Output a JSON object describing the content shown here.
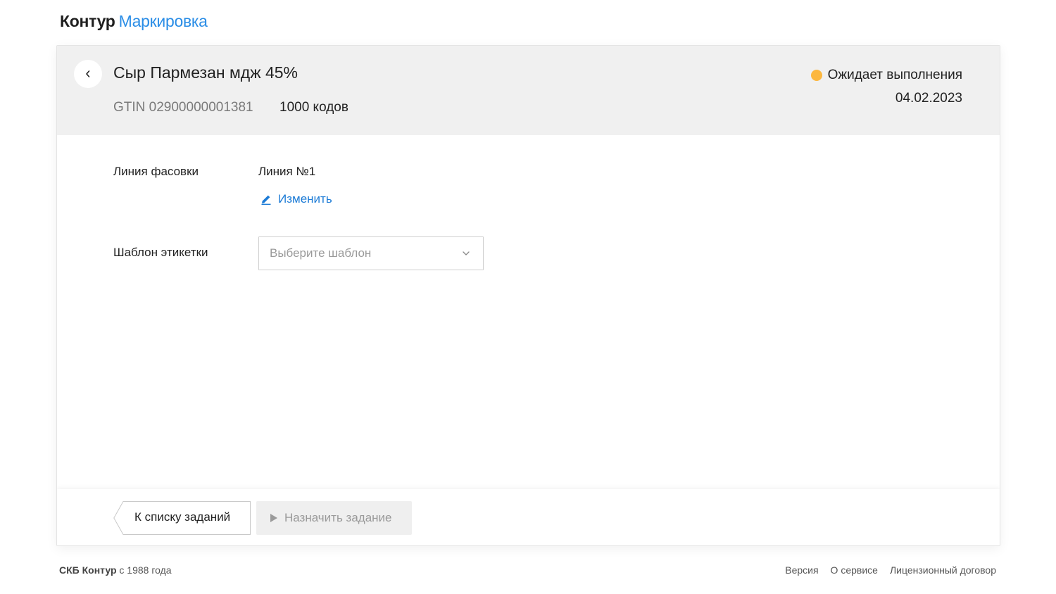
{
  "header": {
    "brand": "Контур",
    "product": "Маркировка"
  },
  "task": {
    "title": "Сыр Пармезан мдж 45%",
    "gtin": "GTIN 02900000001381",
    "codes_count": "1000 кодов",
    "status": "Ожидает выполнения",
    "status_color": "#fcb73e",
    "date": "04.02.2023"
  },
  "form": {
    "line_label": "Линия фасовки",
    "line_value": "Линия №1",
    "edit_label": "Изменить",
    "template_label": "Шаблон этикетки",
    "template_placeholder": "Выберите шаблон"
  },
  "actions": {
    "back_to_list": "К списку заданий",
    "assign_task": "Назначить задание"
  },
  "footer": {
    "company": "СКБ Контур",
    "since": "с 1988 года",
    "links": [
      "Версия",
      "О сервисе",
      "Лицензионный договор"
    ]
  },
  "colors": {
    "accent": "#2a8de6",
    "link": "#1c7bd6",
    "header_bg": "#f0f0f0"
  }
}
